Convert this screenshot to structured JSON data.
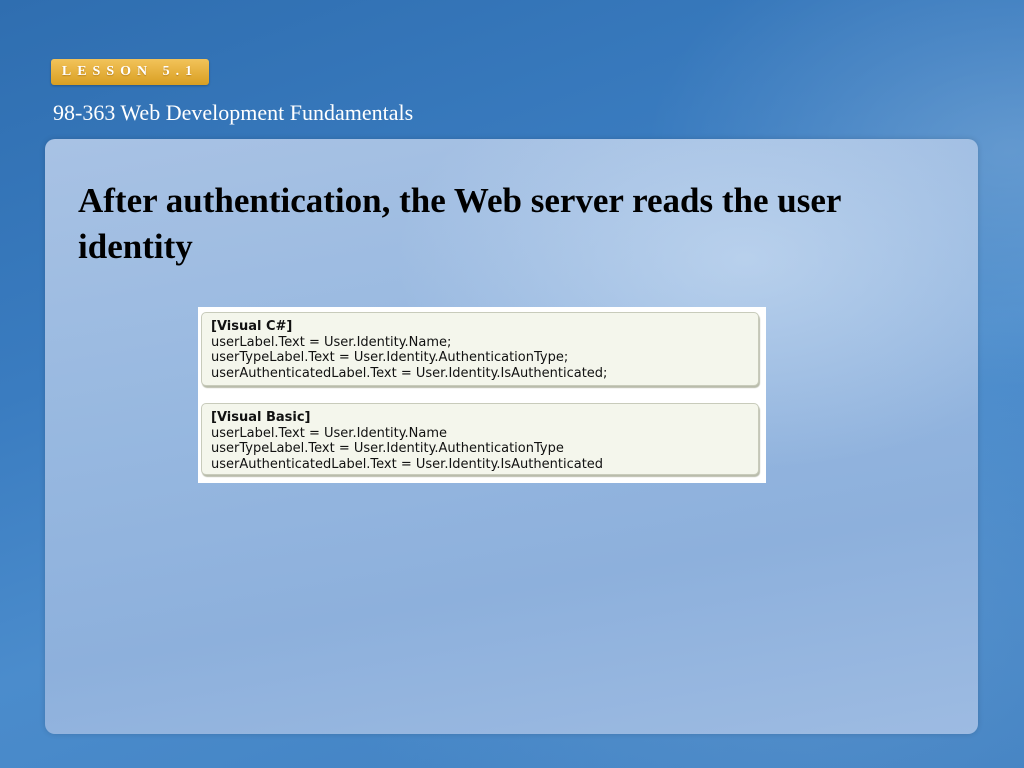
{
  "header": {
    "lesson_badge": "LESSON 5.1",
    "course_title": "98-363 Web Development Fundamentals"
  },
  "slide": {
    "heading": "After authentication, the Web server reads the user identity"
  },
  "code_samples": [
    {
      "language_header": "[Visual C#]",
      "lines": [
        "userLabel.Text = User.Identity.Name;",
        "userTypeLabel.Text = User.Identity.AuthenticationType;",
        "userAuthenticatedLabel.Text = User.Identity.IsAuthenticated;"
      ]
    },
    {
      "language_header": "[Visual Basic]",
      "lines": [
        "userLabel.Text = User.Identity.Name",
        "userTypeLabel.Text = User.Identity.AuthenticationType",
        "userAuthenticatedLabel.Text = User.Identity.IsAuthenticated"
      ]
    }
  ],
  "colors": {
    "badge": "#e8b23d",
    "background": "#3a7cc0",
    "panel": "#97b8e0",
    "code_box": "#f4f6ec"
  }
}
